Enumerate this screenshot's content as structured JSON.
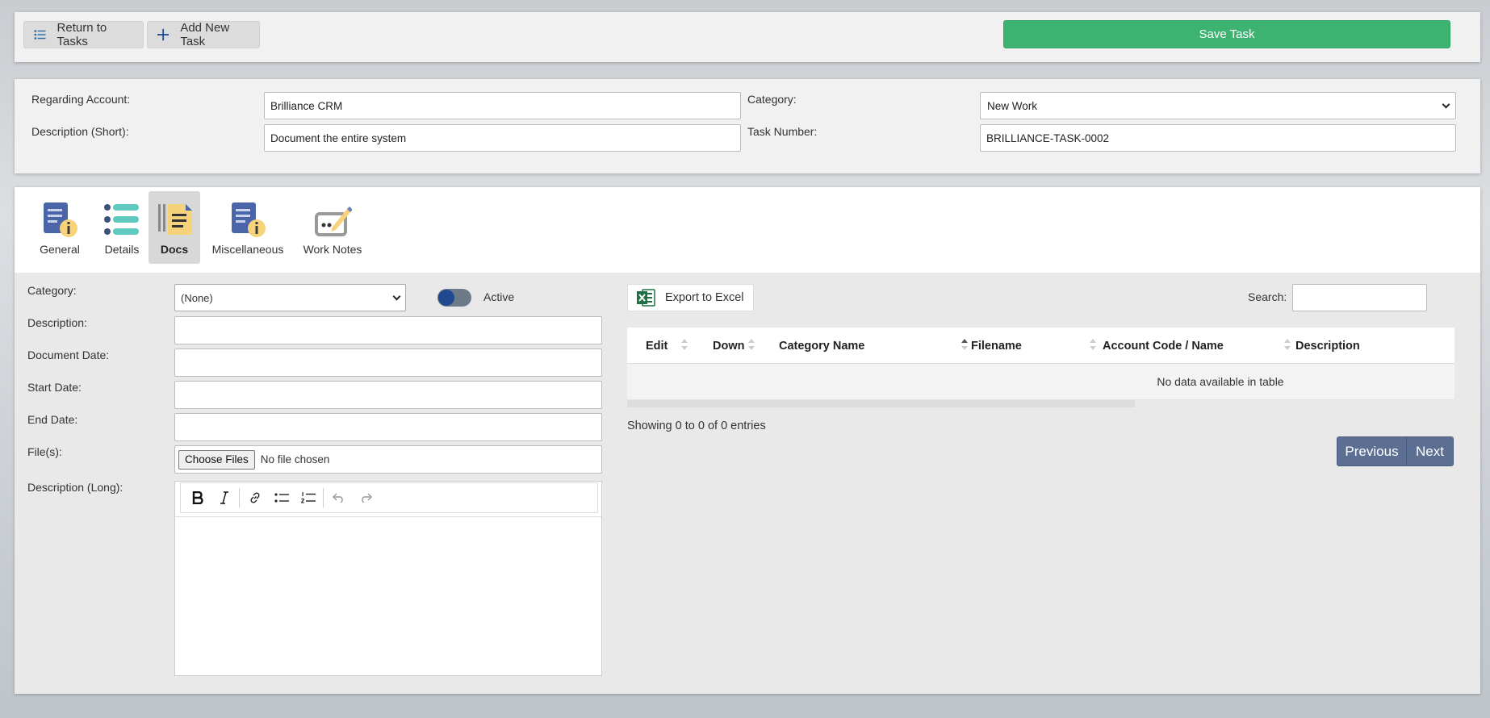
{
  "toolbar": {
    "return_label": "Return to Tasks",
    "add_label": "Add New Task",
    "save_label": "Save Task"
  },
  "header": {
    "regarding_label": "Regarding Account:",
    "regarding_value": "Brilliance CRM",
    "category_label": "Category:",
    "category_value": "New Work",
    "short_desc_label": "Description (Short):",
    "short_desc_value": "Document the entire system",
    "task_number_label": "Task Number:",
    "task_number_value": "BRILLIANCE-TASK-0002"
  },
  "tabs": [
    {
      "label": "General",
      "icon": "document-info-icon"
    },
    {
      "label": "Details",
      "icon": "list-icon"
    },
    {
      "label": "Docs",
      "icon": "docs-icon",
      "active": true
    },
    {
      "label": "Miscellaneous",
      "icon": "document-info-icon"
    },
    {
      "label": "Work Notes",
      "icon": "notes-pencil-icon"
    }
  ],
  "doc_form": {
    "category_label": "Category:",
    "category_value": "(None)",
    "active_label": "Active",
    "description_label": "Description:",
    "document_date_label": "Document Date:",
    "start_date_label": "Start Date:",
    "end_date_label": "End Date:",
    "files_label": "File(s):",
    "choose_files_label": "Choose Files",
    "no_file_label": "No file chosen",
    "long_desc_label": "Description (Long):"
  },
  "grid": {
    "export_label": "Export to Excel",
    "search_label": "Search:",
    "columns": [
      "Edit",
      "Down",
      "Category Name",
      "Filename",
      "Account Code / Name",
      "Description"
    ],
    "empty_text": "No data available in table",
    "showing_text": "Showing 0 to 0 of 0 entries",
    "previous_label": "Previous",
    "next_label": "Next"
  },
  "colors": {
    "save_green": "#3cb371",
    "pager_blue": "#5c6e92",
    "toggle_blue": "#1f4a8f"
  }
}
